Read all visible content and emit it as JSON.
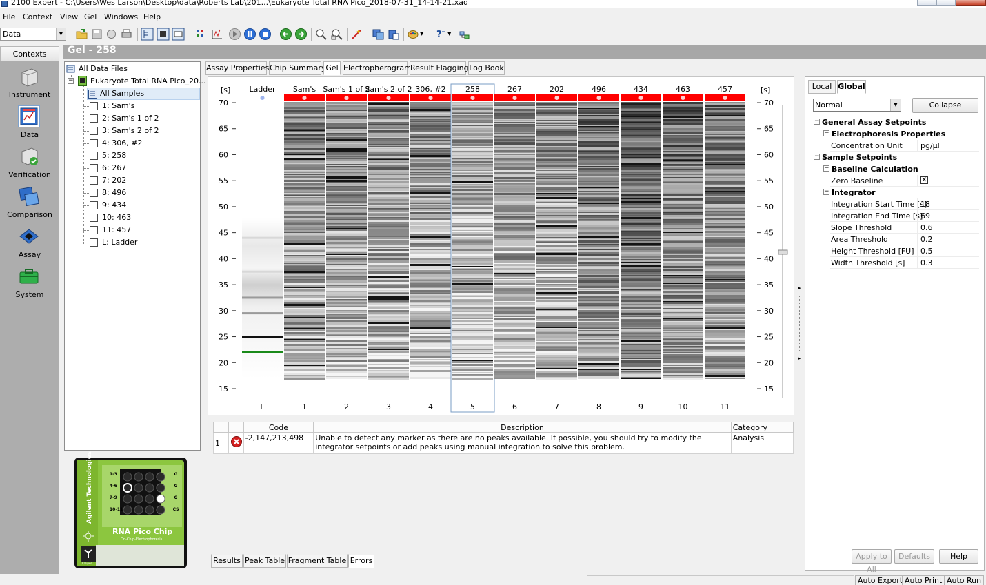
{
  "window": {
    "title": "2100 Expert - C:\\Users\\Wes Larson\\Desktop\\data\\Roberts Lab\\201...\\Eukaryote Total RNA Pico_2018-07-31_14-14-21.xad"
  },
  "menu": [
    "File",
    "Context",
    "View",
    "Gel",
    "Windows",
    "Help"
  ],
  "toolbar": {
    "context_select": "Data",
    "icons": [
      "open-folder-icon",
      "save-icon",
      "refresh-icon",
      "print-icon",
      "tree-view-icon",
      "gel-view-icon",
      "data-view-icon",
      "grid-icon",
      "chart-icon",
      "play-icon",
      "pause-icon",
      "stop-icon",
      "back-icon",
      "forward-icon",
      "zoom-in-icon",
      "zoom-out-icon",
      "wand-icon",
      "copy-icon",
      "paste-icon",
      "palette-icon",
      "help-icon",
      "network-icon"
    ]
  },
  "contexts": {
    "header": "Contexts",
    "items": [
      {
        "label": "Instrument",
        "icon": "instrument-icon"
      },
      {
        "label": "Data",
        "icon": "data-icon"
      },
      {
        "label": "Verification",
        "icon": "verification-icon"
      },
      {
        "label": "Comparison",
        "icon": "comparison-icon"
      },
      {
        "label": "Assay",
        "icon": "assay-icon"
      },
      {
        "label": "System",
        "icon": "system-icon"
      }
    ],
    "selected": "Data"
  },
  "gel_header": "Gel - 258",
  "tree": {
    "root": "All Data Files",
    "file": "Eukaryote Total RNA Pico_20...",
    "all_samples": "All Samples",
    "samples": [
      "1: Sam's",
      "2: Sam's 1 of 2",
      "3: Sam's 2 of 2",
      "4: 306, #2",
      "5: 258",
      "6: 267",
      "7: 202",
      "8: 496",
      "9: 434",
      "10: 463",
      "11: 457",
      "L: Ladder"
    ]
  },
  "chip": {
    "brand": "Agilent Technologies",
    "name": "RNA Pico Chip",
    "subtitle": "On-Chip-Electrophoresis",
    "maker": "Caliper",
    "row_labels": [
      "1-3",
      "4-6",
      "7-9",
      "10-11"
    ],
    "side_labels": [
      "G",
      "G",
      "G",
      "CS"
    ]
  },
  "main_tabs": [
    "Assay Properties",
    "Chip Summary",
    "Gel",
    "Electropherogram",
    "Result Flagging",
    "Log Book"
  ],
  "main_tab_active": "Gel",
  "gel": {
    "axis_unit": "[s]",
    "y_ticks": [
      70,
      65,
      60,
      55,
      50,
      45,
      40,
      35,
      30,
      25,
      20,
      15
    ],
    "ladder_label": "Ladder",
    "lanes": [
      {
        "name": "Sam's",
        "number": "1"
      },
      {
        "name": "Sam's 1 of 2",
        "number": "2"
      },
      {
        "name": "Sam's 2 of 2",
        "number": "3"
      },
      {
        "name": "306, #2",
        "number": "4"
      },
      {
        "name": "258",
        "number": "5"
      },
      {
        "name": "267",
        "number": "6"
      },
      {
        "name": "202",
        "number": "7"
      },
      {
        "name": "496",
        "number": "8"
      },
      {
        "name": "434",
        "number": "9"
      },
      {
        "name": "463",
        "number": "10"
      },
      {
        "name": "457",
        "number": "11"
      }
    ],
    "ladder_number": "L",
    "selected_lane": "5",
    "ladder_bands_s": [
      44,
      37.5,
      32.5,
      29.5,
      25,
      22
    ],
    "flag_color": "#ff0000",
    "marker_color": "#1a8a1a"
  },
  "errors": {
    "headers": [
      "",
      "",
      "Code",
      "Description",
      "Category"
    ],
    "rows": [
      {
        "index": "1",
        "code": "-2,147,213,498",
        "description": "Unable to detect any marker as there are no peaks available. If possible, you should try to modify the integrator setpoints or add peaks using manual integration to solve this problem.",
        "category": "Analysis"
      }
    ]
  },
  "bottom_tabs": [
    "Results",
    "Peak Table",
    "Fragment Table",
    "Errors"
  ],
  "bottom_tab_active": "Errors",
  "setpoints": {
    "tabs": [
      "Local",
      "Global"
    ],
    "active_tab": "Global",
    "mode": "Normal",
    "collapse_label": "Collapse",
    "sections": [
      {
        "level": 0,
        "label": "General Assay Setpoints"
      },
      {
        "level": 1,
        "label": "Electrophoresis Properties"
      },
      {
        "level": 2,
        "label": "Concentration Unit",
        "value": "pg/µl"
      },
      {
        "level": 0,
        "label": "Sample Setpoints"
      },
      {
        "level": 1,
        "label": "Baseline Calculation"
      },
      {
        "level": 2,
        "label": "Zero Baseline",
        "checkbox": true
      },
      {
        "level": 1,
        "label": "Integrator"
      },
      {
        "level": 2,
        "label": "Integration Start Time [s]",
        "value": "18"
      },
      {
        "level": 2,
        "label": "Integration End Time [s]",
        "value": "69"
      },
      {
        "level": 2,
        "label": "Slope Threshold",
        "value": "0.6"
      },
      {
        "level": 2,
        "label": "Area Threshold",
        "value": "0.2"
      },
      {
        "level": 2,
        "label": "Height Threshold [FU]",
        "value": "0.5"
      },
      {
        "level": 2,
        "label": "Width Threshold [s]",
        "value": "0.3"
      }
    ],
    "apply_all_label": "Apply to All",
    "defaults_label": "Defaults",
    "help_label": "Help"
  },
  "status": [
    "Auto Export",
    "Auto Print",
    "Auto Run"
  ]
}
